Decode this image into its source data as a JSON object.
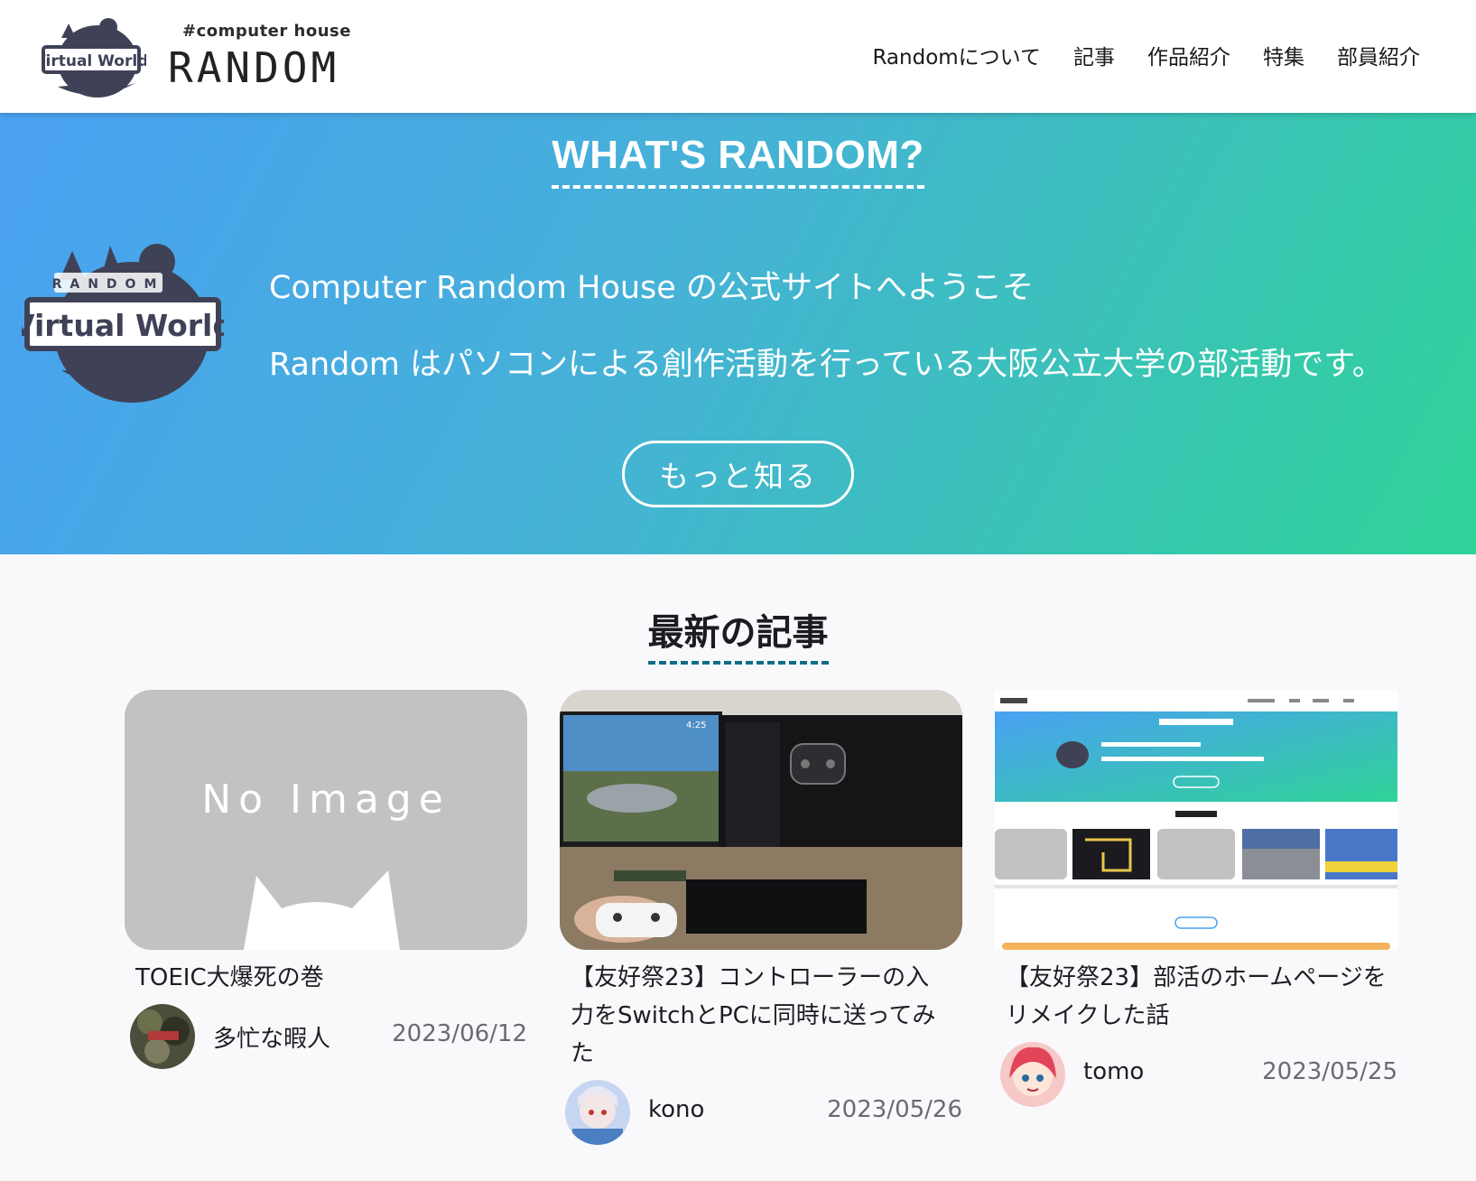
{
  "header": {
    "logo_tag": "#computer house",
    "logo_name": "RANDOM",
    "nav": [
      "Randomについて",
      "記事",
      "作品紹介",
      "特集",
      "部員紹介"
    ]
  },
  "hero": {
    "title": "WHAT'S RANDOM?",
    "line1": "Computer Random House の公式サイトへようこそ",
    "line2": "Random はパソコンによる創作活動を行っている大阪公立大学の部活動です。",
    "button": "もっと知る"
  },
  "latest": {
    "title": "最新の記事",
    "cards": [
      {
        "title": "TOEIC大爆死の巻",
        "author": "多忙な暇人",
        "date": "2023/06/12",
        "thumb": "No Image"
      },
      {
        "title": "【友好祭23】コントローラーの入力をSwitchとPCに同時に送ってみた",
        "author": "kono",
        "date": "2023/05/26"
      },
      {
        "title": "【友好祭23】部活のホームページをリメイクした話",
        "author": "tomo",
        "date": "2023/05/25"
      }
    ]
  },
  "colors": {
    "hero_start": "#4aa1f2",
    "hero_end": "#2fd398",
    "accent_dash": "#0f6d86",
    "noimage_gray": "#c2c2c2"
  }
}
